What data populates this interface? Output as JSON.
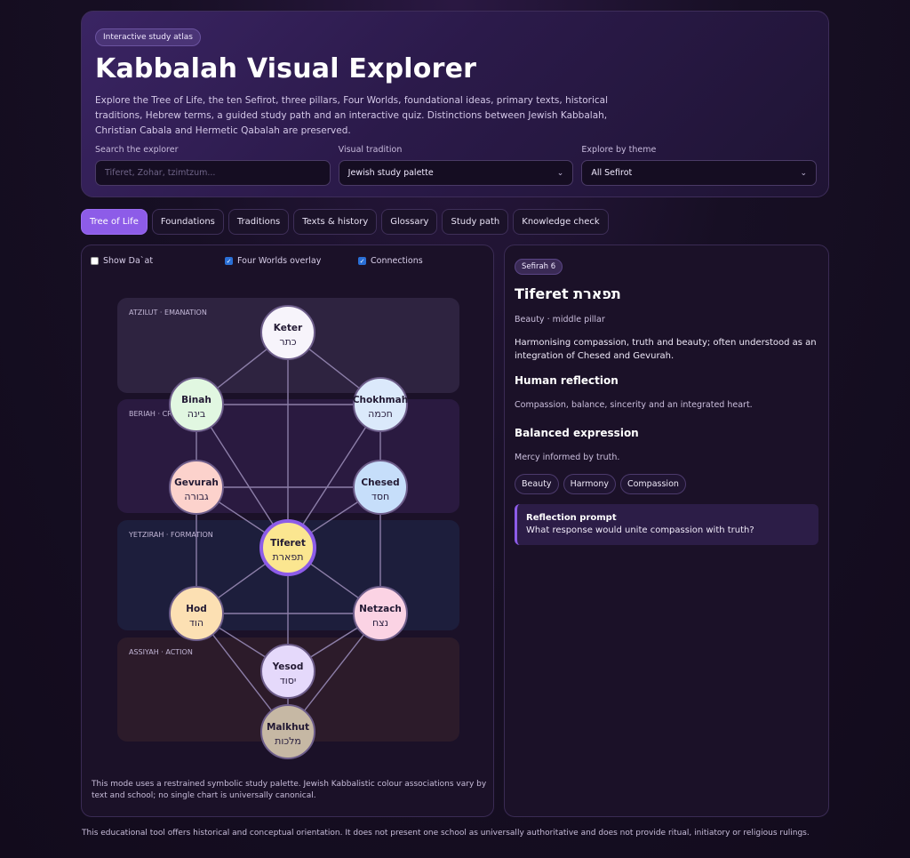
{
  "header": {
    "badge": "Interactive study atlas",
    "title": "Kabbalah Visual Explorer",
    "intro": "Explore the Tree of Life, the ten Sefirot, three pillars, Four Worlds, foundational ideas, primary texts, historical traditions, Hebrew terms, a guided study path and an interactive quiz. Distinctions between Jewish Kabbalah, Christian Cabala and Hermetic Qabalah are preserved."
  },
  "controls": {
    "search_label": "Search the explorer",
    "search_placeholder": "Tiferet, Zohar, tzimtzum...",
    "tradition_label": "Visual tradition",
    "tradition_value": "Jewish study palette",
    "theme_label": "Explore by theme",
    "theme_value": "All Sefirot"
  },
  "tabs": [
    "Tree of Life",
    "Foundations",
    "Traditions",
    "Texts & history",
    "Glossary",
    "Study path",
    "Knowledge check"
  ],
  "options": {
    "show_daat": "Show Da`at",
    "four_worlds": "Four Worlds overlay",
    "connections": "Connections"
  },
  "worlds": [
    {
      "label": "ATZILUT · EMANATION",
      "color": "#2e2340"
    },
    {
      "label": "BERIAH · CREATION",
      "color": "#2a1a40"
    },
    {
      "label": "YETZIRAH · FORMATION",
      "color": "#1d1e3c"
    },
    {
      "label": "ASSIYAH · ACTION",
      "color": "#2c1b2a"
    }
  ],
  "sefirot": [
    {
      "id": "keter",
      "name": "Keter",
      "hebrew": "כתר",
      "color": "#f7f4fb"
    },
    {
      "id": "binah",
      "name": "Binah",
      "hebrew": "בינה",
      "color": "#e1f7e1"
    },
    {
      "id": "chokhmah",
      "name": "Chokhmah",
      "hebrew": "חכמה",
      "color": "#dbe9fb"
    },
    {
      "id": "gevurah",
      "name": "Gevurah",
      "hebrew": "גבורה",
      "color": "#fcd2cc"
    },
    {
      "id": "chesed",
      "name": "Chesed",
      "hebrew": "חסד",
      "color": "#c6defa"
    },
    {
      "id": "tiferet",
      "name": "Tiferet",
      "hebrew": "תפארת",
      "color": "#fbe690"
    },
    {
      "id": "hod",
      "name": "Hod",
      "hebrew": "הוד",
      "color": "#fce0b3"
    },
    {
      "id": "netzach",
      "name": "Netzach",
      "hebrew": "נצח",
      "color": "#fbd3e4"
    },
    {
      "id": "yesod",
      "name": "Yesod",
      "hebrew": "יסוד",
      "color": "#e5d9fb"
    },
    {
      "id": "malkhut",
      "name": "Malkhut",
      "hebrew": "מלכות",
      "color": "#c6b8a4"
    }
  ],
  "selected": "tiferet",
  "accent": "#8d5ce8",
  "note": "This mode uses a restrained symbolic study palette. Jewish Kabbalistic colour associations vary by text and school; no single chart is universally canonical.",
  "detail": {
    "badge": "Sefirah 6",
    "name": "Tiferet",
    "hebrew": "תפארת",
    "subtitle": "Beauty · middle pillar",
    "description": "Harmonising compassion, truth and beauty; often understood as an integration of Chesed and Gevurah.",
    "human_heading": "Human reflection",
    "human_text": "Compassion, balance, sincerity and an integrated heart.",
    "balanced_heading": "Balanced expression",
    "balanced_text": "Mercy informed by truth.",
    "tags": [
      "Beauty",
      "Harmony",
      "Compassion"
    ],
    "prompt_title": "Reflection prompt",
    "prompt_text": "What response would unite compassion with truth?"
  },
  "footer": "This educational tool offers historical and conceptual orientation. It does not present one school as universally authoritative and does not provide ritual, initiatory or religious rulings."
}
